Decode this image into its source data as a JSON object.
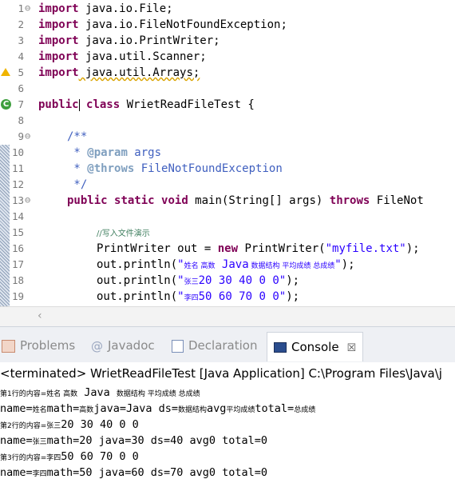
{
  "editor": {
    "gutter": {
      "line_numbers": [
        "1",
        "2",
        "3",
        "4",
        "5",
        "6",
        "7",
        "8",
        "9",
        "10",
        "11",
        "12",
        "13",
        "14",
        "15",
        "16",
        "17",
        "18",
        "19"
      ],
      "fold_markers": [
        "⊖",
        "⊖",
        "⊖"
      ]
    },
    "lines": {
      "l1": {
        "kw": "import",
        "rest": " java.io.File;"
      },
      "l2": {
        "kw": "import",
        "rest": " java.io.FileNotFoundException;"
      },
      "l3": {
        "kw": "import",
        "rest": " java.io.PrintWriter;"
      },
      "l4": {
        "kw": "import",
        "rest": " java.util.Scanner;"
      },
      "l5": {
        "kw": "import",
        "rest": " java.util.Arrays;"
      },
      "l7": {
        "kw1": "public",
        "kw2": "class",
        "rest": " WrietReadFileTest {"
      },
      "l9": {
        "text": "/**"
      },
      "l10": {
        "star": " * ",
        "tag": "@param",
        "rest": " args"
      },
      "l11": {
        "star": " * ",
        "tag": "@throws",
        "rest": " FileNotFoundException"
      },
      "l12": {
        "text": " */"
      },
      "l13": {
        "kw1": "public",
        "kw2": "static",
        "kw3": "void",
        "mid": " main(String[] args) ",
        "kw4": "throws",
        "rest": " FileNot"
      },
      "l15": {
        "text": "//写入文件演示"
      },
      "l16": {
        "pre": "PrintWriter out = ",
        "kw": "new",
        "mid": " PrintWriter(",
        "str": "\"myfile.txt\"",
        "post": ");"
      },
      "l17": {
        "pre": "out.println(",
        "str_a": "\"",
        "str_cn": "姓名 高数",
        "str_b": "Java",
        "str_cn2": " 数据结构 平均成绩 总成绩",
        "str_c": "\"",
        "post": ");"
      },
      "l18": {
        "pre": "out.println(",
        "str_a": "\"",
        "str_cn": "张三",
        "str_b": "20 30 40 0 0\"",
        "post": ");"
      },
      "l19": {
        "pre": "out.println(",
        "str_a": "\"",
        "str_cn": "李四",
        "str_b": "50 60 70 0 0\"",
        "post": ");"
      }
    }
  },
  "tabs": {
    "problems": "Problems",
    "javadoc": "Javadoc",
    "declaration": "Declaration",
    "console": "Console",
    "console_close": "☒"
  },
  "console": {
    "status": "<terminated> WrietReadFileTest [Java Application] C:\\Program Files\\Java\\j",
    "lines": [
      {
        "cn1": "第1行的内容=姓名 高数",
        "b": " Java ",
        "cn2": "数据结构 平均成绩 总成绩"
      },
      {
        "a": "name=",
        "cn1": "姓名",
        "b": "math=",
        "cn2": "高数",
        "c": "java=Java ds=",
        "cn3": "数据结构",
        "d": "avg",
        "cn4": "平均成绩",
        "e": "total=",
        "cn5": "总成绩"
      },
      {
        "cn1": "第2行的内容=张三",
        "b": "20 30 40 0 0"
      },
      {
        "a": "name=",
        "cn1": "张三",
        "b": "math=20 java=30 ds=40 avg0 total=0"
      },
      {
        "cn1": "第3行的内容=李四",
        "b": "50 60 70 0 0"
      },
      {
        "a": "name=",
        "cn1": "李四",
        "b": "math=50 java=60 ds=70 avg0 total=0"
      }
    ]
  },
  "colors": {
    "keyword": "#7f0055",
    "string": "#2a00ff",
    "comment": "#3f7f5f",
    "javadoc": "#3f5fbf"
  }
}
